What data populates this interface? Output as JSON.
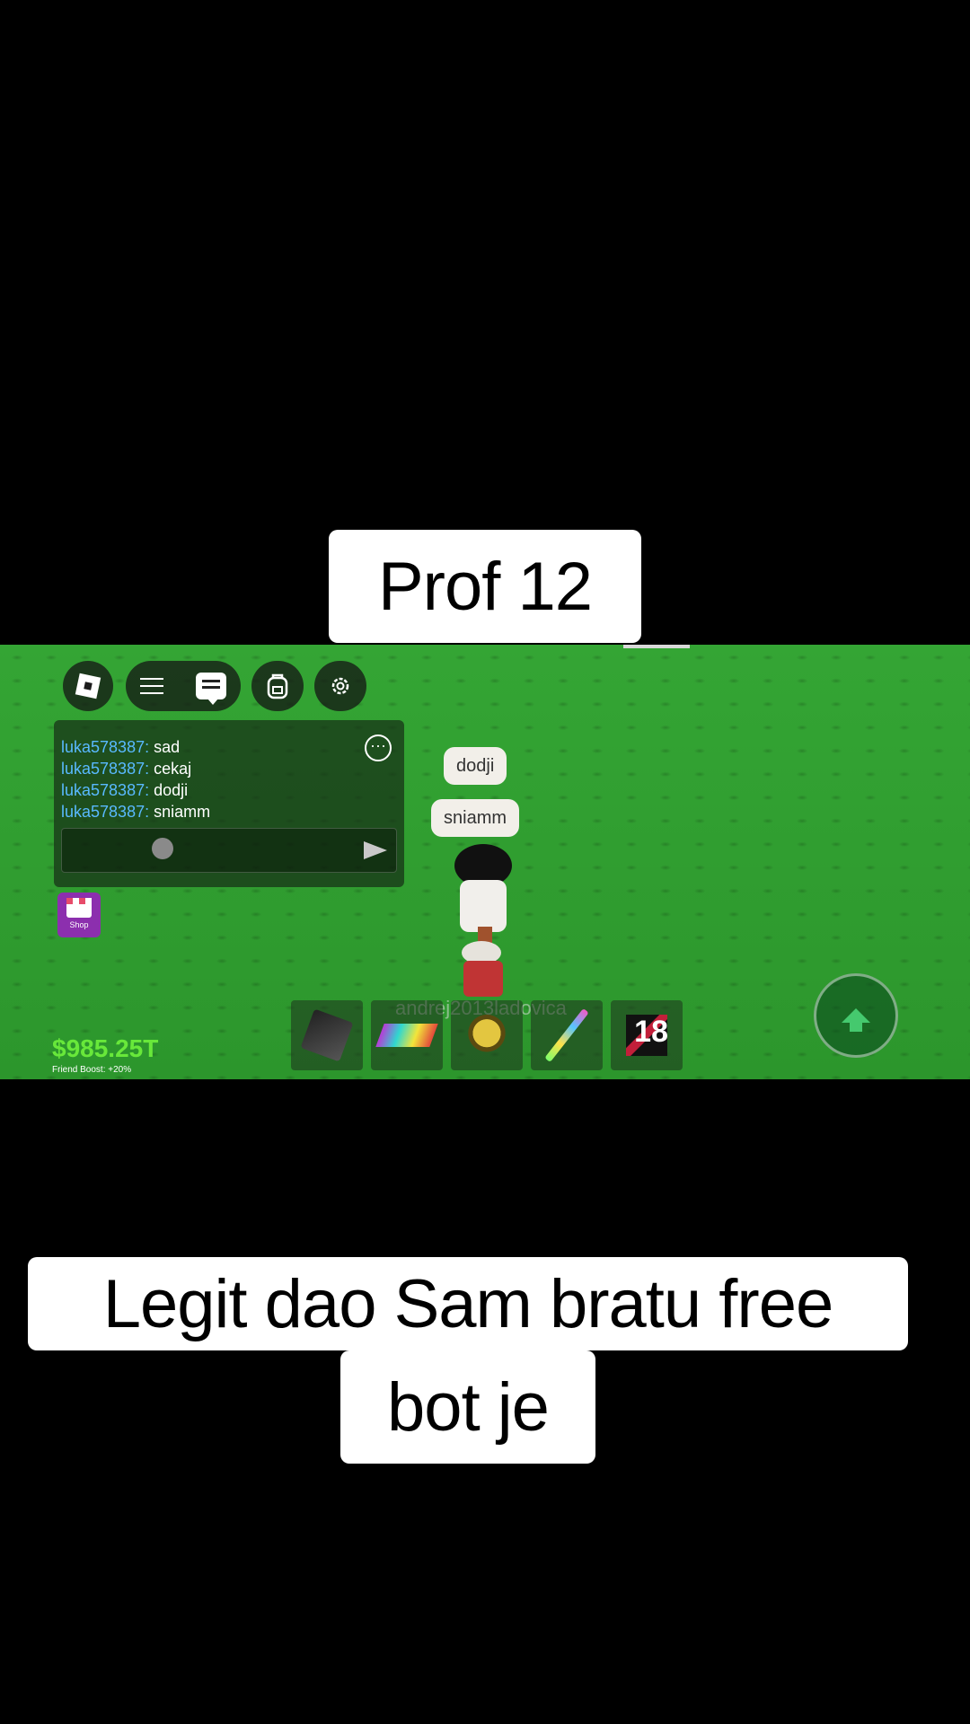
{
  "captions": {
    "top": "Prof 12",
    "bottom_line1": "Legit dao Sam bratu free",
    "bottom_line2": "bot je"
  },
  "chat": {
    "messages": [
      {
        "user": "luka578387:",
        "text": "sad"
      },
      {
        "user": "luka578387:",
        "text": "cekaj"
      },
      {
        "user": "luka578387:",
        "text": "dodji"
      },
      {
        "user": "luka578387:",
        "text": "sniamm"
      }
    ],
    "more_icon": "more-options-icon",
    "send_icon": "send-icon"
  },
  "bubbles": [
    "dodji",
    "sniamm"
  ],
  "player_name": "andrej2013ladovica",
  "shop": {
    "label": "Shop"
  },
  "hud": {
    "money": "$985.25T",
    "friend_boost": "Friend Boost: +20%"
  },
  "hotbar": {
    "slots": [
      {
        "name": "cape",
        "label": ""
      },
      {
        "name": "carpet",
        "label": ""
      },
      {
        "name": "mask",
        "label": ""
      },
      {
        "name": "sword",
        "label": ""
      },
      {
        "name": "dark-item",
        "label": "18"
      }
    ]
  },
  "colors": {
    "grass": "#2f9a2f",
    "money": "#68e83a",
    "username": "#59b9ff",
    "shop": "#8c2fae"
  }
}
